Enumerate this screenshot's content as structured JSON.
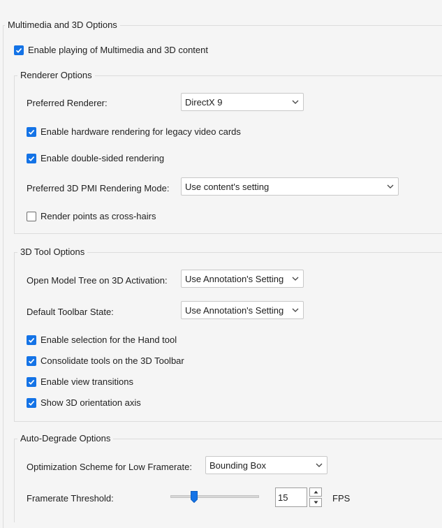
{
  "multimedia": {
    "title": "Multimedia and 3D Options",
    "enable_label": "Enable playing of Multimedia and 3D content",
    "enable_checked": true
  },
  "renderer": {
    "title": "Renderer Options",
    "preferred_label": "Preferred Renderer:",
    "preferred_value": "DirectX 9",
    "hw_label": "Enable hardware rendering for legacy video cards",
    "hw_checked": true,
    "double_label": "Enable double-sided rendering",
    "double_checked": true,
    "pmi_label": "Preferred 3D PMI Rendering Mode:",
    "pmi_value": "Use content's setting",
    "crosshair_label": "Render points as cross-hairs",
    "crosshair_checked": false
  },
  "tool": {
    "title": "3D Tool Options",
    "model_tree_label": "Open Model Tree on 3D Activation:",
    "model_tree_value": "Use Annotation's Setting",
    "toolbar_label": "Default Toolbar State:",
    "toolbar_value": "Use Annotation's Setting",
    "hand_label": "Enable selection for the Hand tool",
    "consolidate_label": "Consolidate tools on the 3D Toolbar",
    "transitions_label": "Enable view transitions",
    "axis_label": "Show 3D orientation axis"
  },
  "degrade": {
    "title": "Auto-Degrade Options",
    "scheme_label": "Optimization Scheme for Low Framerate:",
    "scheme_value": "Bounding Box",
    "threshold_label": "Framerate Threshold:",
    "threshold_value": "15",
    "threshold_unit": "FPS",
    "slider_fraction": 0.27
  },
  "colors": {
    "accent": "#1473e6"
  }
}
